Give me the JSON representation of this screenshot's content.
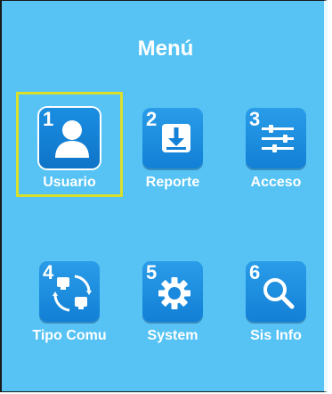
{
  "title": "Menú",
  "colors": {
    "background": "#56c3f4",
    "tile": "#1a88dc",
    "selection": "#d8e02c",
    "text": "#ffffff"
  },
  "items": [
    {
      "number": "1",
      "label": "Usuario",
      "icon": "user-icon",
      "selected": true
    },
    {
      "number": "2",
      "label": "Reporte",
      "icon": "download-icon",
      "selected": false
    },
    {
      "number": "3",
      "label": "Acceso",
      "icon": "sliders-icon",
      "selected": false
    },
    {
      "number": "4",
      "label": "Tipo Comu",
      "icon": "network-icon",
      "selected": false
    },
    {
      "number": "5",
      "label": "System",
      "icon": "gear-icon",
      "selected": false
    },
    {
      "number": "6",
      "label": "Sis Info",
      "icon": "search-icon",
      "selected": false
    }
  ]
}
